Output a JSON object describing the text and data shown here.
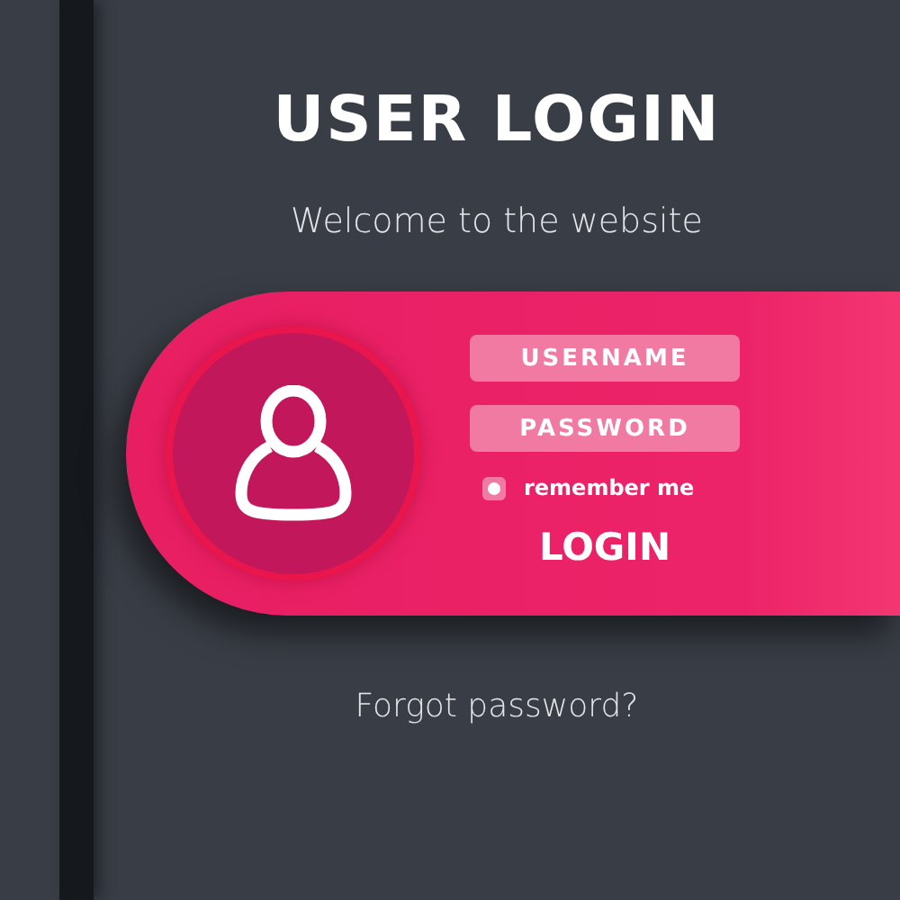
{
  "title": "USER LOGIN",
  "subtitle": "Welcome to the website",
  "form": {
    "fields": [
      {
        "placeholder": "USERNAME"
      },
      {
        "placeholder": "PASSWORD"
      }
    ],
    "remember": {
      "label": "remember me",
      "checked": true
    },
    "button": "LOGIN"
  },
  "forgot_link": "Forgot password?"
}
